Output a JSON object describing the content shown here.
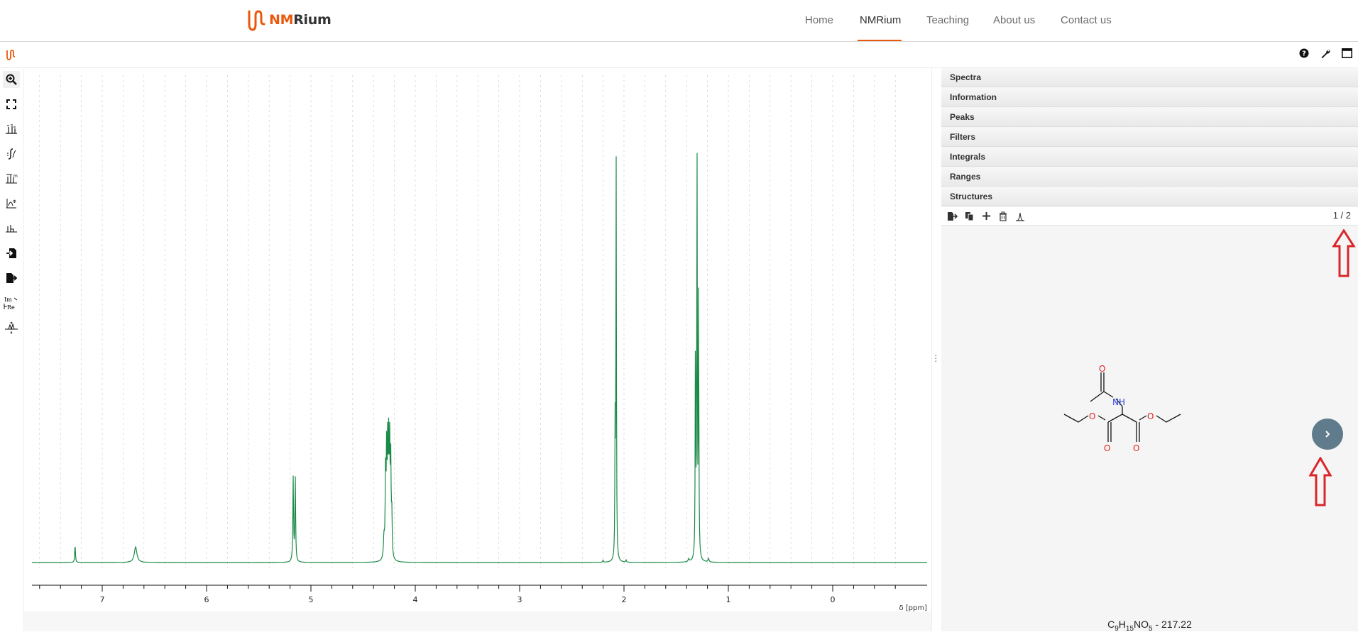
{
  "nav": {
    "logo_prefix": "NM",
    "logo_suffix": "Rium",
    "items": [
      {
        "label": "Home"
      },
      {
        "label": "NMRium"
      },
      {
        "label": "Teaching"
      },
      {
        "label": "About us"
      },
      {
        "label": "Contact us"
      }
    ],
    "active": "NMRium"
  },
  "panels": {
    "spectra": "Spectra",
    "information": "Information",
    "peaks": "Peaks",
    "filters": "Filters",
    "integrals": "Integrals",
    "ranges": "Ranges",
    "structures": "Structures"
  },
  "structures": {
    "pager": "1 / 2",
    "formula_prefix": "C",
    "formula_c": "9",
    "formula_h_label": "H",
    "formula_h": "15",
    "formula_n_label": "NO",
    "formula_o": "5",
    "formula_mass": " - 217.22",
    "atom_nh": "NH",
    "atom_o": "O"
  },
  "axis": {
    "label": "δ [ppm]",
    "ticks": [
      "7",
      "6",
      "5",
      "4",
      "3",
      "2",
      "1",
      "0"
    ]
  },
  "colors": {
    "accent": "#ea580c",
    "spectrum": "#1a8a47",
    "next_button": "#5f7b8c",
    "annotation": "#d9262b"
  },
  "icons": {
    "help": "question-circle-icon",
    "settings": "wrench-icon",
    "window": "window-icon"
  }
}
